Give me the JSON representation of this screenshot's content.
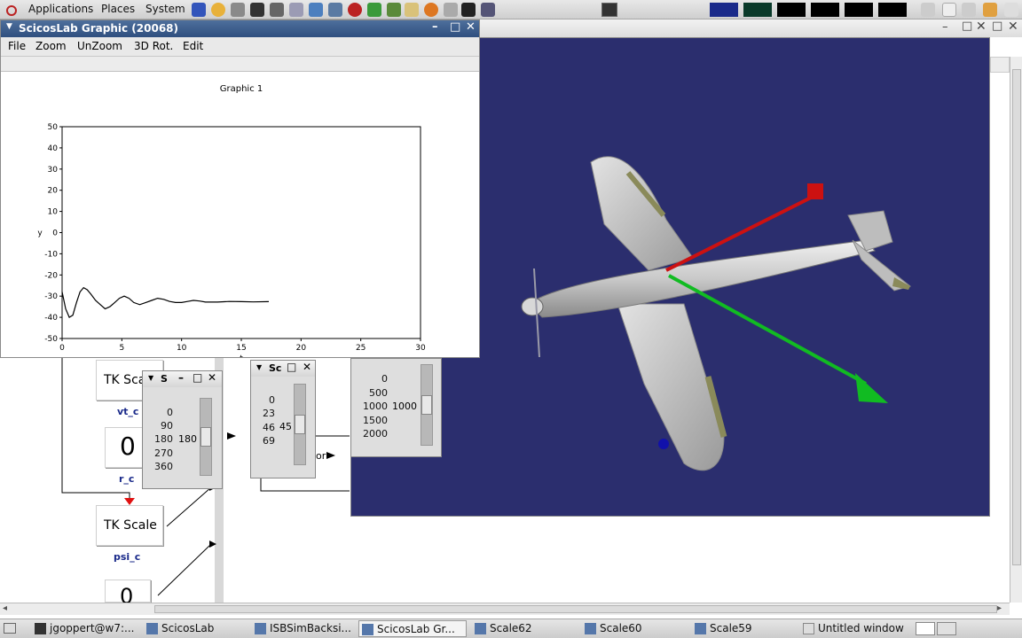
{
  "top_panel": {
    "menus": [
      "Applications",
      "Places",
      "System"
    ]
  },
  "graphic_window": {
    "title": "ScicosLab Graphic (20068)",
    "menu": [
      "File",
      "Zoom",
      "UnZoom",
      "3D Rot.",
      "Edit"
    ]
  },
  "chart_data": {
    "type": "line",
    "title": "Graphic 1",
    "xlabel": "t",
    "ylabel": "y",
    "xlim": [
      0,
      30
    ],
    "ylim": [
      -50,
      50
    ],
    "xticks": [
      0,
      5,
      10,
      15,
      20,
      25,
      30
    ],
    "yticks": [
      50,
      40,
      30,
      20,
      10,
      0,
      -10,
      -20,
      -30,
      -40,
      -50
    ],
    "series": [
      {
        "x": [
          0,
          0.3,
          0.6,
          0.9,
          1.2,
          1.5,
          1.8,
          2.1,
          2.4,
          2.8,
          3.2,
          3.6,
          4.0,
          4.4,
          4.8,
          5.2,
          5.6,
          6.0,
          6.5,
          7.0,
          7.5,
          8.0,
          8.5,
          9.0,
          9.5,
          10.0,
          10.5,
          11.0,
          11.5,
          12.0,
          13.0,
          14.0,
          15.0,
          16.0,
          17.3
        ],
        "y": [
          -28,
          -36,
          -40,
          -39,
          -33,
          -28,
          -26,
          -27,
          -29,
          -32,
          -34,
          -36,
          -35,
          -33,
          -31,
          -30,
          -31,
          -33,
          -34,
          -33,
          -32,
          -31,
          -31.5,
          -32.5,
          -33,
          -33,
          -32.5,
          -32,
          -32.3,
          -32.8,
          -32.8,
          -32.5,
          -32.6,
          -32.7,
          -32.6
        ]
      }
    ]
  },
  "blocks": {
    "tk_scale_1": "TK Sca",
    "tk_scale_2": "TK Scale",
    "vt_label": "vt_c",
    "r_label": "r_c",
    "psi_label": "psi_c",
    "display_1": "0",
    "display_2": "0",
    "or_label": "or"
  },
  "scale_windows": [
    {
      "title": "S",
      "ticks": [
        "0",
        "90",
        "180",
        "270",
        "360"
      ],
      "value": "180",
      "level": 0.5
    },
    {
      "title": "Sc",
      "ticks": [
        "0",
        "23",
        "46",
        "69"
      ],
      "value": "45",
      "level": 0.5
    },
    {
      "title": "",
      "ticks": [
        "0",
        "500",
        "1000",
        "1500",
        "2000"
      ],
      "value": "1000",
      "level": 0.5
    }
  ],
  "taskbar": [
    {
      "label": "jgoppert@w7:...",
      "active": false
    },
    {
      "label": "ScicosLab",
      "active": false
    },
    {
      "label": "ISBSimBacksi...",
      "active": false
    },
    {
      "label": "ScicosLab Gr...",
      "active": true
    },
    {
      "label": "Scale62",
      "active": false
    },
    {
      "label": "Scale60",
      "active": false
    },
    {
      "label": "Scale59",
      "active": false
    },
    {
      "label": "Untitled window",
      "active": false
    }
  ],
  "colors": {
    "viewer_bg": "#2b2e6e",
    "axis_x": "#cc1111",
    "axis_y": "#11bb22",
    "titlebar": "#3b5b8c"
  }
}
